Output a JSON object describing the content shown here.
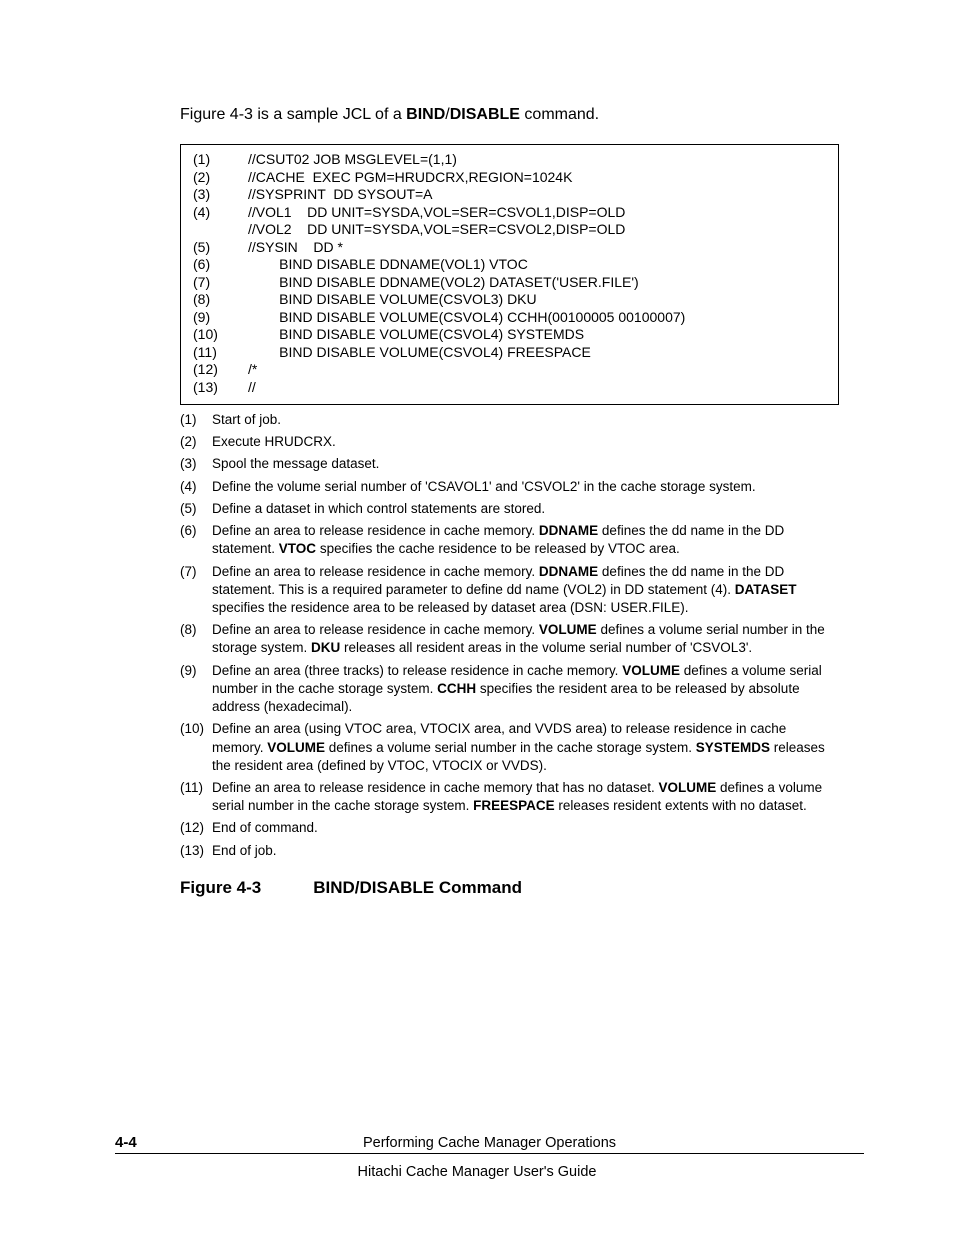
{
  "intro": {
    "pre": "Figure 4-3 is a sample JCL of a ",
    "b1": "BIND",
    "slash": "/",
    "b2": "DISABLE",
    "post": " command."
  },
  "code": [
    {
      "n": "(1)",
      "t": "//CSUT02 JOB MSGLEVEL=(1,1)"
    },
    {
      "n": "(2)",
      "t": "//CACHE  EXEC PGM=HRUDCRX,REGION=1024K"
    },
    {
      "n": "(3)",
      "t": "//SYSPRINT  DD SYSOUT=A"
    },
    {
      "n": "(4)",
      "t": "//VOL1    DD UNIT=SYSDA,VOL=SER=CSVOL1,DISP=OLD"
    },
    {
      "n": "",
      "t": "//VOL2    DD UNIT=SYSDA,VOL=SER=CSVOL2,DISP=OLD"
    },
    {
      "n": "(5)",
      "t": "//SYSIN    DD *"
    },
    {
      "n": "(6)",
      "t": "        BIND DISABLE DDNAME(VOL1) VTOC"
    },
    {
      "n": "(7)",
      "t": "        BIND DISABLE DDNAME(VOL2) DATASET('USER.FILE')"
    },
    {
      "n": "(8)",
      "t": "        BIND DISABLE VOLUME(CSVOL3) DKU"
    },
    {
      "n": "(9)",
      "t": "        BIND DISABLE VOLUME(CSVOL4) CCHH(00100005 00100007)"
    },
    {
      "n": "(10)",
      "t": "        BIND DISABLE VOLUME(CSVOL4) SYSTEMDS"
    },
    {
      "n": "(11)",
      "t": "        BIND DISABLE VOLUME(CSVOL4) FREESPACE"
    },
    {
      "n": "(12)",
      "t": "/*"
    },
    {
      "n": "(13)",
      "t": "//"
    }
  ],
  "notes": [
    {
      "n": "(1)",
      "segs": [
        {
          "t": "Start of job."
        }
      ]
    },
    {
      "n": "(2)",
      "segs": [
        {
          "t": "Execute HRUDCRX."
        }
      ]
    },
    {
      "n": "(3)",
      "segs": [
        {
          "t": "Spool the message dataset."
        }
      ]
    },
    {
      "n": "(4)",
      "segs": [
        {
          "t": "Define the volume serial number of 'CSAVOL1' and 'CSVOL2' in the cache storage system."
        }
      ]
    },
    {
      "n": "(5)",
      "segs": [
        {
          "t": "Define a dataset in which control statements are stored."
        }
      ]
    },
    {
      "n": "(6)",
      "segs": [
        {
          "t": "Define an area to release residence in cache memory. "
        },
        {
          "b": true,
          "t": "DDNAME"
        },
        {
          "t": " defines the dd name in the DD statement. "
        },
        {
          "b": true,
          "t": "VTOC"
        },
        {
          "t": " specifies the cache residence to be released by VTOC area."
        }
      ]
    },
    {
      "n": "(7)",
      "segs": [
        {
          "t": "Define an area to release residence in cache memory. "
        },
        {
          "b": true,
          "t": "DDNAME"
        },
        {
          "t": " defines the dd name in the DD statement. This is a required parameter to define dd name (VOL2) in DD statement (4). "
        },
        {
          "b": true,
          "t": "DATASET"
        },
        {
          "t": " specifies the residence area to be released by dataset area (DSN: USER.FILE)."
        }
      ]
    },
    {
      "n": "(8)",
      "segs": [
        {
          "t": "Define an area to release residence in cache memory. "
        },
        {
          "b": true,
          "t": "VOLUME"
        },
        {
          "t": " defines a volume serial number in the storage system.  "
        },
        {
          "b": true,
          "t": "DKU"
        },
        {
          "t": " releases all resident areas in the volume serial number of 'CSVOL3'."
        }
      ]
    },
    {
      "n": "(9)",
      "segs": [
        {
          "t": "Define an area (three tracks) to release residence in cache memory. "
        },
        {
          "b": true,
          "t": "VOLUME"
        },
        {
          "t": " defines a volume serial number in the cache storage system. "
        },
        {
          "b": true,
          "t": "CCHH"
        },
        {
          "t": " specifies the resident area to be released by absolute address (hexadecimal)."
        }
      ]
    },
    {
      "n": "(10)",
      "segs": [
        {
          "t": "Define an area (using VTOC area, VTOCIX area, and VVDS area) to release residence in cache memory. "
        },
        {
          "b": true,
          "t": "VOLUME"
        },
        {
          "t": " defines a volume serial number in the cache storage system. "
        },
        {
          "b": true,
          "t": "SYSTEMDS"
        },
        {
          "t": " releases the resident area (defined by VTOC, VTOCIX or VVDS)."
        }
      ]
    },
    {
      "n": "(11)",
      "segs": [
        {
          "t": "Define an area to release residence in cache memory that has no dataset. "
        },
        {
          "b": true,
          "t": "VOLUME"
        },
        {
          "t": " defines a volume serial number in the cache storage system. "
        },
        {
          "b": true,
          "t": "FREESPACE"
        },
        {
          "t": " releases resident extents with no dataset."
        }
      ]
    },
    {
      "n": "(12)",
      "segs": [
        {
          "t": "End of command."
        }
      ]
    },
    {
      "n": "(13)",
      "segs": [
        {
          "t": "End of job."
        }
      ]
    }
  ],
  "figcap": {
    "num": "Figure 4-3",
    "title": "BIND/DISABLE Command"
  },
  "footer": {
    "page": "4-4",
    "center": "Performing Cache Manager Operations",
    "guide": "Hitachi Cache Manager User's Guide"
  }
}
